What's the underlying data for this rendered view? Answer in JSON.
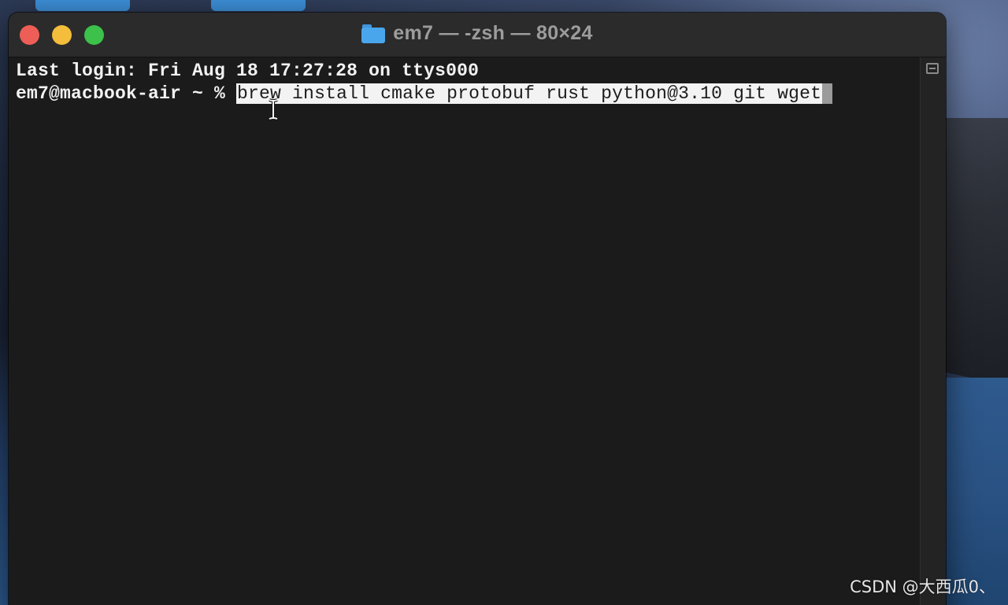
{
  "window": {
    "title": "em7 — -zsh — 80×24"
  },
  "terminal": {
    "last_login": "Last login: Fri Aug 18 17:27:28 on ttys000",
    "prompt": "em7@macbook-air ~ % ",
    "command": "brew install cmake protobuf rust python@3.10 git wget"
  },
  "watermark": "CSDN @大西瓜0、",
  "colors": {
    "close": "#ed5e57",
    "minimize": "#f4bd3b",
    "zoom": "#3cc14a",
    "terminal_bg": "#1b1b1b",
    "selection_bg": "#f3f3f3"
  },
  "icons": {
    "title": "folder-icon",
    "scroll": "split-pane-icon",
    "pointer": "ibeam-cursor-icon"
  }
}
